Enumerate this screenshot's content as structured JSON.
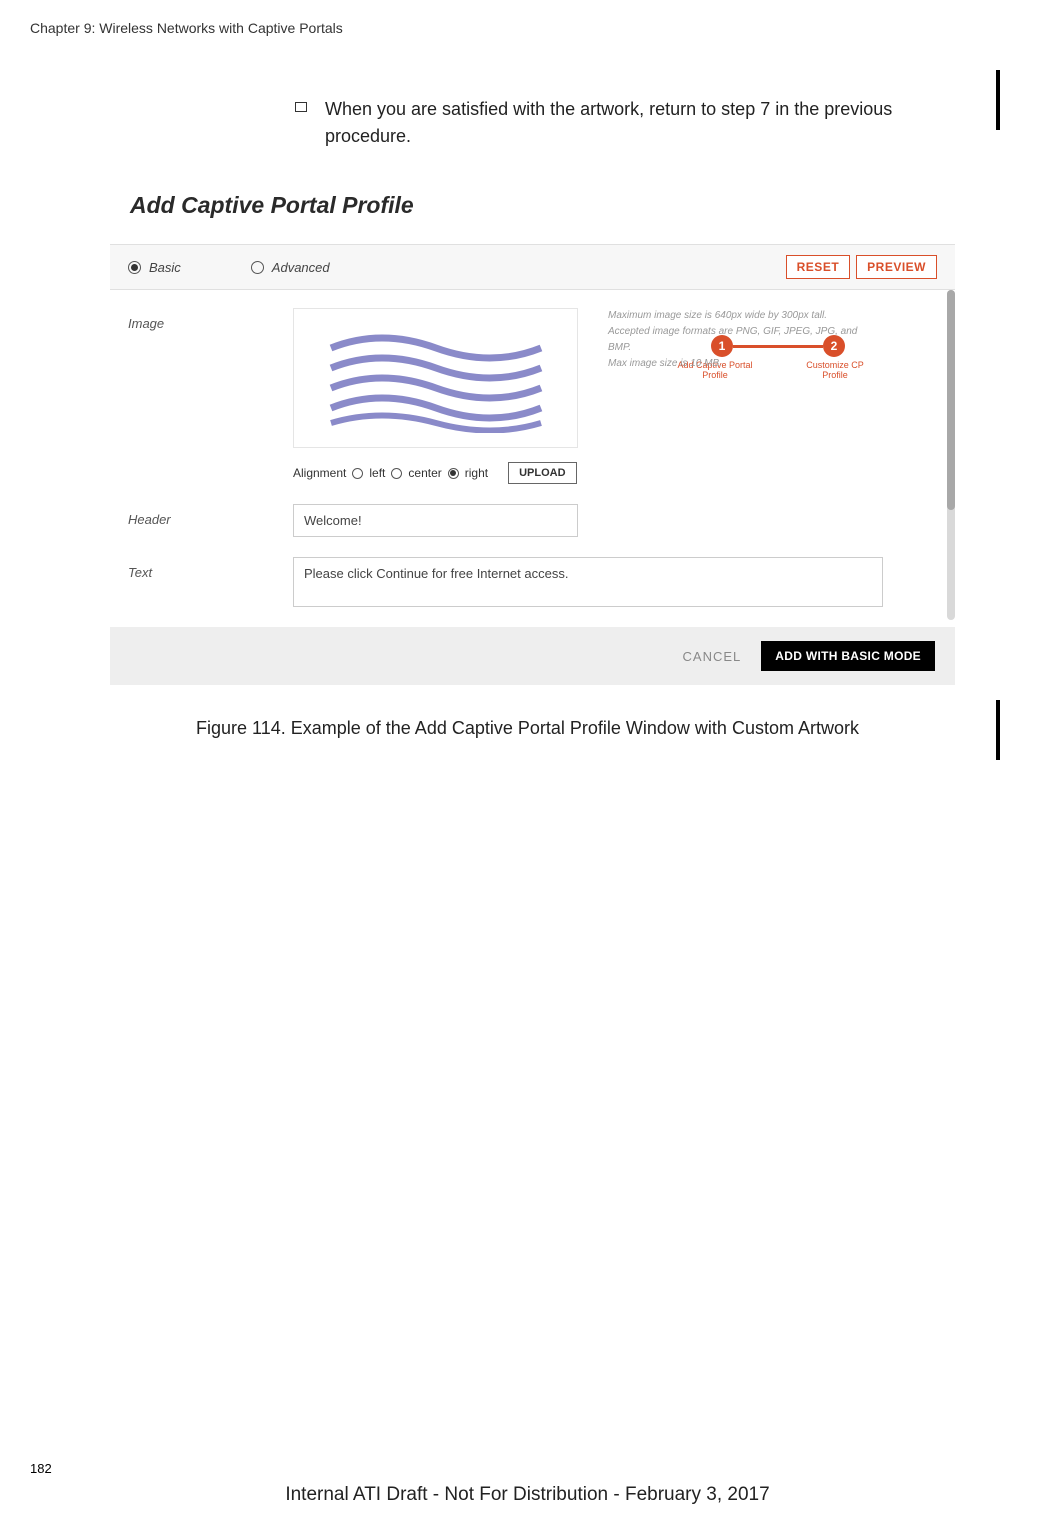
{
  "chapter": "Chapter 9: Wireless Networks with Captive Portals",
  "instruction": "When you are satisfied with the artwork, return to step 7 in the previous procedure.",
  "panel": {
    "title": "Add Captive Portal Profile",
    "step1_num": "1",
    "step2_num": "2",
    "step1_label": "Add Captive Portal Profile",
    "step2_label": "Customize CP Profile",
    "basic_label": "Basic",
    "advanced_label": "Advanced",
    "reset_btn": "RESET",
    "preview_btn": "PREVIEW",
    "image_label": "Image",
    "hint1": "Maximum image size is 640px wide by 300px tall.",
    "hint2": "Accepted image formats are PNG, GIF, JPEG, JPG, and BMP.",
    "hint3": "Max image size is 10 MB.",
    "alignment_label": "Alignment",
    "align_left": "left",
    "align_center": "center",
    "align_right": "right",
    "upload_btn": "UPLOAD",
    "header_label": "Header",
    "header_value": "Welcome!",
    "text_label": "Text",
    "text_value": "Please click Continue for free Internet access.",
    "cancel_btn": "CANCEL",
    "add_btn": "ADD WITH BASIC MODE"
  },
  "figure_caption": "Figure 114. Example of the Add Captive Portal Profile Window with Custom Artwork",
  "page_number": "182",
  "footer": "Internal ATI Draft - Not For Distribution - February 3, 2017"
}
